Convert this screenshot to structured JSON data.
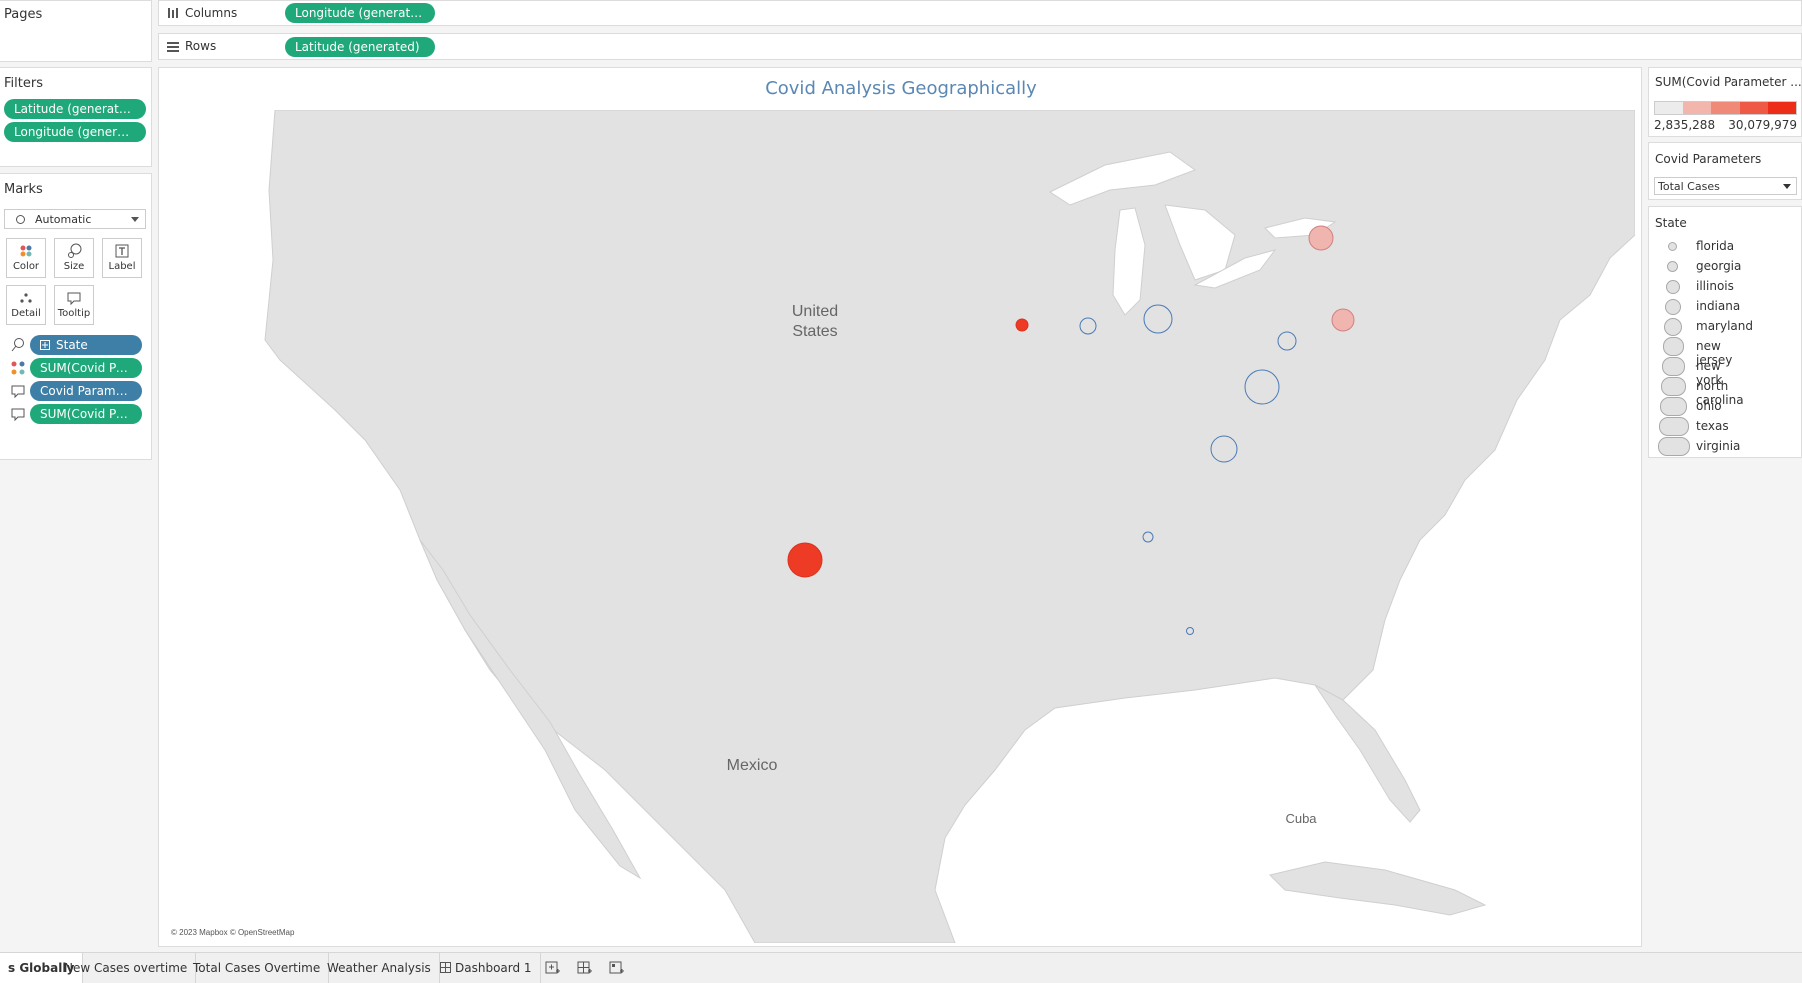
{
  "shelves": {
    "pages_label": "Pages",
    "columns_label": "Columns",
    "columns_pill": "Longitude (generated)",
    "rows_label": "Rows",
    "rows_pill": "Latitude (generated)"
  },
  "filters": {
    "title": "Filters",
    "items": [
      "Latitude (generated)",
      "Longitude (generated)"
    ]
  },
  "marks": {
    "title": "Marks",
    "type": "Automatic",
    "cards": [
      "Color",
      "Size",
      "Label",
      "Detail",
      "Tooltip"
    ],
    "fields": [
      {
        "icon": "detail-icon",
        "label": "State",
        "kind": "dimension"
      },
      {
        "icon": "color-icon",
        "label": "SUM(Covid Par..",
        "kind": "measure"
      },
      {
        "icon": "tooltip-icon",
        "label": "Covid Paramet..",
        "kind": "dimension"
      },
      {
        "icon": "tooltip-icon",
        "label": "SUM(Covid Par..",
        "kind": "measure"
      }
    ]
  },
  "view": {
    "title": "Covid Analysis Geographically",
    "map_labels": {
      "us_line1": "United",
      "us_line2": "States",
      "mexico": "Mexico",
      "cuba": "Cuba",
      "attribution": "© 2023 Mapbox © OpenStreetMap"
    }
  },
  "color_legend": {
    "title": "SUM(Covid Parameter ...",
    "min_label": "2,835,288",
    "max_label": "30,079,979",
    "colors": [
      "#ececec",
      "#f3b6ac",
      "#ef8a79",
      "#ee5a45",
      "#ee2d18"
    ]
  },
  "parameter": {
    "title": "Covid Parameters",
    "value": "Total Cases"
  },
  "size_legend": {
    "title": "State",
    "items": [
      "florida",
      "georgia",
      "illinois",
      "indiana",
      "maryland",
      "new jersey",
      "new york",
      "north carolina",
      "ohio",
      "texas",
      "virginia"
    ]
  },
  "chart_data": {
    "type": "scatter",
    "title": "Covid Analysis Geographically",
    "xlabel": "Longitude (generated)",
    "ylabel": "Latitude (generated)",
    "points": [
      {
        "state": "texas",
        "color": "#ee3b25"
      },
      {
        "state": "illinois",
        "color": "#ee3b25"
      },
      {
        "state": "new york",
        "color": "#f1b5b0"
      },
      {
        "state": "new jersey",
        "color": "#f1b5b0"
      },
      {
        "state": "indiana",
        "color": "none"
      },
      {
        "state": "ohio",
        "color": "none"
      },
      {
        "state": "maryland",
        "color": "none"
      },
      {
        "state": "virginia",
        "color": "none"
      },
      {
        "state": "north carolina",
        "color": "none"
      },
      {
        "state": "georgia",
        "color": "none"
      },
      {
        "state": "florida",
        "color": "none"
      }
    ]
  },
  "tabs": [
    {
      "label": "s Globally",
      "active": true
    },
    {
      "label": "New Cases overtime",
      "active": false
    },
    {
      "label": "Total Cases Overtime",
      "active": false
    },
    {
      "label": "Weather Analysis",
      "active": false
    },
    {
      "label": "Dashboard 1",
      "active": false
    }
  ]
}
